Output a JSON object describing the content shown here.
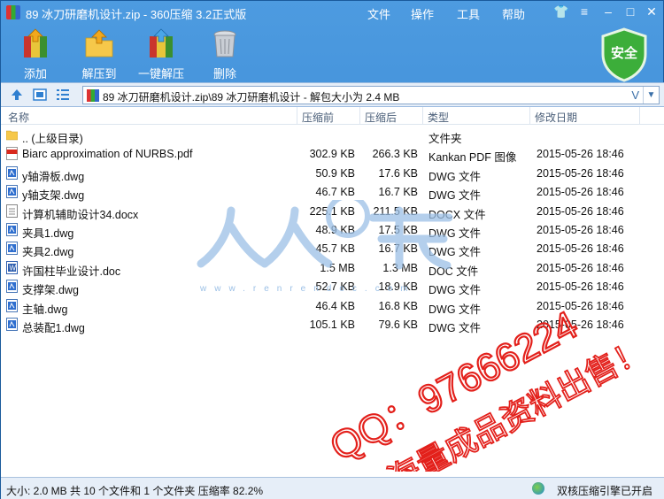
{
  "window": {
    "title": "89 冰刀研磨机设计.zip - 360压缩 3.2正式版",
    "menu": [
      "文件",
      "操作",
      "工具",
      "帮助"
    ]
  },
  "toolbar": {
    "add": "添加",
    "extract_to": "解压到",
    "one_click_extract": "一键解压",
    "delete": "删除",
    "safe_badge": "安全"
  },
  "address": {
    "path": "89 冰刀研磨机设计.zip\\89 冰刀研磨机设计 - 解包大小为 2.4 MB",
    "v_label": "V"
  },
  "columns": [
    "名称",
    "压缩前",
    "压缩后",
    "类型",
    "修改日期"
  ],
  "files": [
    {
      "name": ".. (上级目录)",
      "orig": "",
      "comp": "",
      "type": "文件夹",
      "date": "",
      "icon": "folder-icon"
    },
    {
      "name": "Biarc approximation of NURBS.pdf",
      "orig": "302.9 KB",
      "comp": "266.3 KB",
      "type": "Kankan PDF 图像",
      "date": "2015-05-26 18:46",
      "icon": "pdf-icon"
    },
    {
      "name": "y轴滑板.dwg",
      "orig": "50.9 KB",
      "comp": "17.6 KB",
      "type": "DWG 文件",
      "date": "2015-05-26 18:46",
      "icon": "dwg-icon"
    },
    {
      "name": "y轴支架.dwg",
      "orig": "46.7 KB",
      "comp": "16.7 KB",
      "type": "DWG 文件",
      "date": "2015-05-26 18:46",
      "icon": "dwg-icon"
    },
    {
      "name": "计算机辅助设计34.docx",
      "orig": "225.1 KB",
      "comp": "211.5 KB",
      "type": "DOCX 文件",
      "date": "2015-05-26 18:46",
      "icon": "docx-icon"
    },
    {
      "name": "夹具1.dwg",
      "orig": "48.9 KB",
      "comp": "17.5 KB",
      "type": "DWG 文件",
      "date": "2015-05-26 18:46",
      "icon": "dwg-icon"
    },
    {
      "name": "夹具2.dwg",
      "orig": "45.7 KB",
      "comp": "16.7 KB",
      "type": "DWG 文件",
      "date": "2015-05-26 18:46",
      "icon": "dwg-icon"
    },
    {
      "name": "许国柱毕业设计.doc",
      "orig": "1.5 MB",
      "comp": "1.3 MB",
      "type": "DOC 文件",
      "date": "2015-05-26 18:46",
      "icon": "doc-icon"
    },
    {
      "name": "支撑架.dwg",
      "orig": "52.7 KB",
      "comp": "18.9 KB",
      "type": "DWG 文件",
      "date": "2015-05-26 18:46",
      "icon": "dwg-icon"
    },
    {
      "name": "主轴.dwg",
      "orig": "46.4 KB",
      "comp": "16.8 KB",
      "type": "DWG 文件",
      "date": "2015-05-26 18:46",
      "icon": "dwg-icon"
    },
    {
      "name": "总装配1.dwg",
      "orig": "105.1 KB",
      "comp": "79.6 KB",
      "type": "DWG 文件",
      "date": "2015-05-26 18:46",
      "icon": "dwg-icon"
    }
  ],
  "watermark": {
    "url": "www.renrendoc.com",
    "qq_line": "QQ：97666224",
    "sale_line": "海量成品资料出售！"
  },
  "status": {
    "left": "大小: 2.0 MB 共 10 个文件和 1 个文件夹 压缩率 82.2%",
    "right": "双核压缩引擎已开启"
  },
  "colors": {
    "title_blue": "#2b7acb",
    "safe_green": "#3cae3a",
    "watermark_red": "#e3201b",
    "watermark_blue": "#9cc0e6"
  }
}
